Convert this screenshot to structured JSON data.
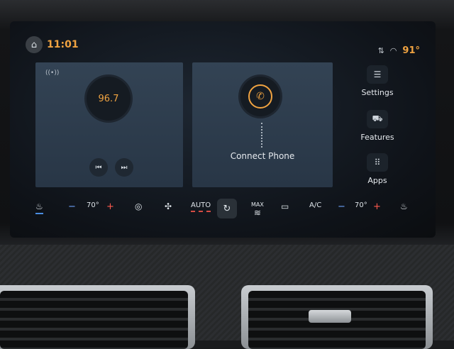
{
  "header": {
    "time": "11:01",
    "outside_temp": "91°",
    "home_icon": "home-icon",
    "status_icons": [
      "sort-icon",
      "wifi-icon"
    ]
  },
  "radio_card": {
    "frequency": "96.7",
    "prev_icon": "previous-track-icon",
    "next_icon": "next-track-icon"
  },
  "phone_card": {
    "label": "Connect Phone"
  },
  "side_menu": {
    "settings": "Settings",
    "features": "Features",
    "apps": "Apps"
  },
  "climate": {
    "left_temp": "70°",
    "right_temp": "70°",
    "auto": "AUTO",
    "max": "MAX",
    "ac": "A/C"
  },
  "colors": {
    "accent": "#f0a341",
    "heat": "#ff5a4f",
    "cool": "#6fa6ff"
  }
}
